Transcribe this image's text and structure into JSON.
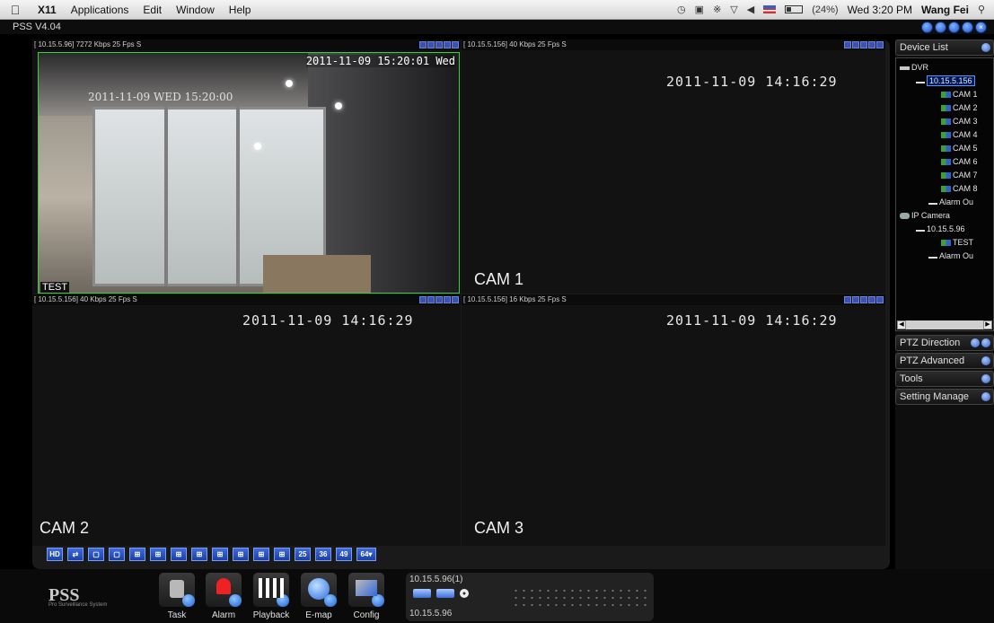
{
  "menubar": {
    "app_name": "X11",
    "items": [
      "Applications",
      "Edit",
      "Window",
      "Help"
    ],
    "status": {
      "battery": "(24%)",
      "clock": "Wed 3:20 PM",
      "user": "Wang Fei"
    }
  },
  "app": {
    "title": "PSS V4.04"
  },
  "tiles": [
    {
      "header": "[ 10.15.5.96] 7272 Kbps 25 Fps S",
      "cam_label": "",
      "time": "",
      "osd_top": "2011-11-09 15:20:01 Wed",
      "osd_old": "2011-11-09 WED 15:20:00",
      "osd_test": "TEST"
    },
    {
      "header": "[ 10.15.5.156] 40 Kbps 25 Fps S",
      "cam_label": "CAM 1",
      "time": "2011-11-09 14:16:29"
    },
    {
      "header": "[ 10.15.5.156] 40 Kbps 25 Fps S",
      "cam_label": "CAM 2",
      "time": "2011-11-09 14:16:29"
    },
    {
      "header": "[ 10.15.5.156] 16 Kbps 25 Fps S",
      "cam_label": "CAM 3",
      "time": "2011-11-09 14:16:29"
    }
  ],
  "layout_toolbar": {
    "buttons": [
      "HD",
      "",
      "",
      "",
      "",
      "",
      "",
      "",
      "",
      "",
      "",
      "",
      "25",
      "36",
      "49",
      "64▾"
    ]
  },
  "sidebar": {
    "device_list": "Device List",
    "tree": {
      "dvr": "DVR",
      "dvr_ip": "10.15.5.156",
      "cams": [
        "CAM 1",
        "CAM 2",
        "CAM 3",
        "CAM 4",
        "CAM 5",
        "CAM 6",
        "CAM 7",
        "CAM 8"
      ],
      "alarm": "Alarm Ou",
      "ipcam": "IP Camera",
      "ipcam_ip": "10.15.5.96",
      "test": "TEST",
      "alarm2": "Alarm Ou"
    },
    "ptz_direction": "PTZ Direction",
    "ptz_advanced": "PTZ Advanced",
    "tools": "Tools",
    "setting_manager": "Setting Manage"
  },
  "footer": {
    "logo": "PSS",
    "logo_sub": "Pro Surveillance System",
    "buttons": [
      "Task",
      "Alarm",
      "Playback",
      "E-map",
      "Config"
    ],
    "device_top": "10.15.5.96(1)",
    "device_bottom": "10.15.5.96"
  }
}
